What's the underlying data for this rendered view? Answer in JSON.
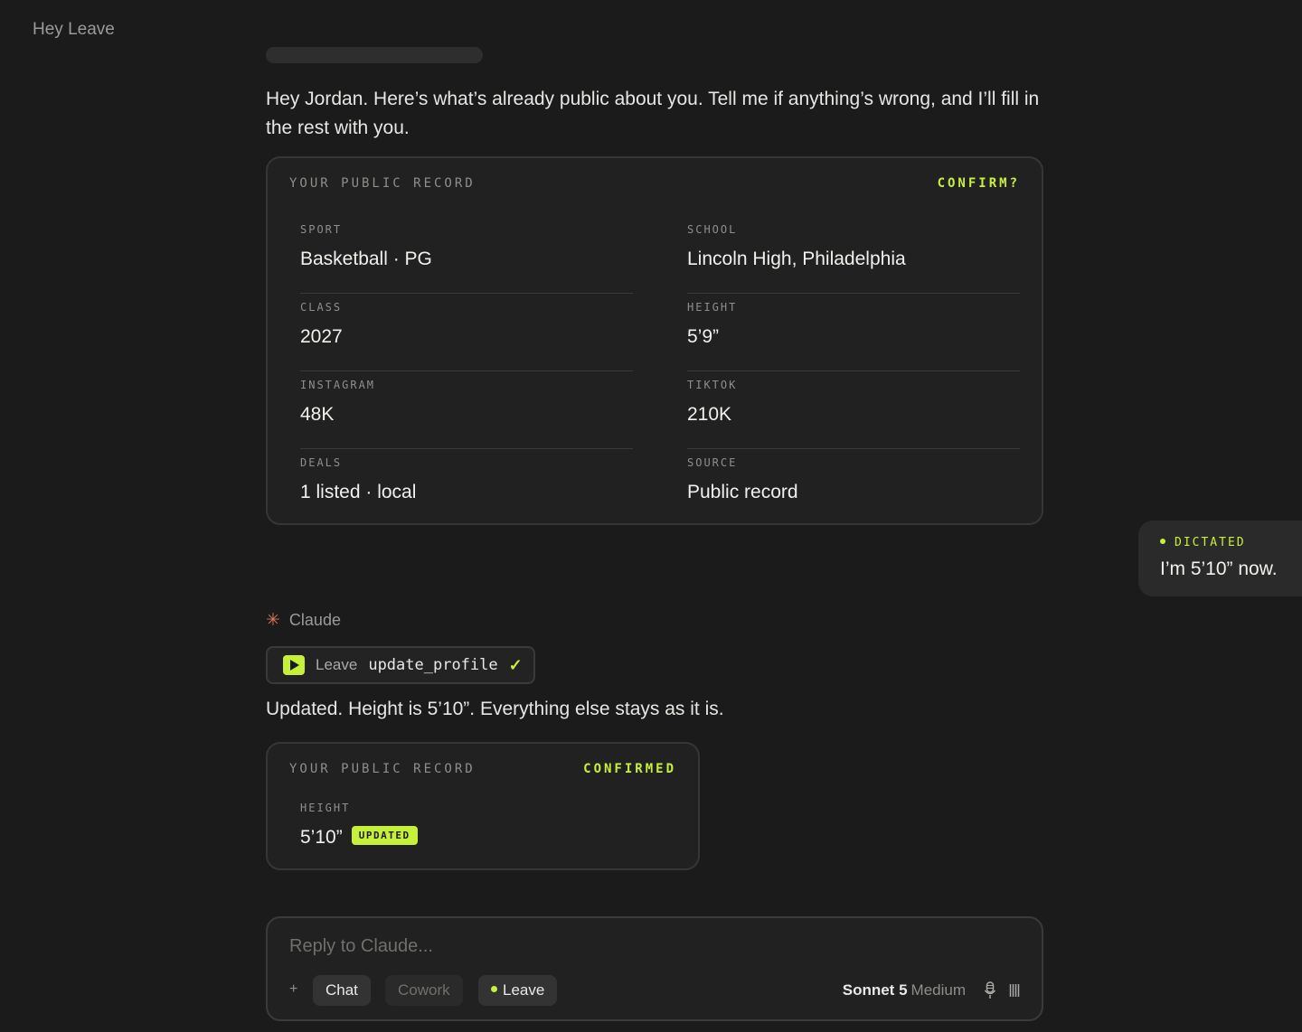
{
  "app": {
    "title": "Hey Leave"
  },
  "intro": "Hey Jordan. Here’s what’s already public about you. Tell me if anything’s wrong, and I’ll fill in the rest with you.",
  "record_card": {
    "title": "YOUR PUBLIC RECORD",
    "status": "CONFIRM?",
    "fields": [
      {
        "label": "SPORT",
        "value": "Basketball · PG"
      },
      {
        "label": "SCHOOL",
        "value": "Lincoln High, Philadelphia"
      },
      {
        "label": "CLASS",
        "value": "2027"
      },
      {
        "label": "HEIGHT",
        "value": "5’9”"
      },
      {
        "label": "INSTAGRAM",
        "value": "48K"
      },
      {
        "label": "TIKTOK",
        "value": "210K"
      },
      {
        "label": "DEALS",
        "value": "1 listed · local"
      },
      {
        "label": "SOURCE",
        "value": "Public record"
      }
    ]
  },
  "user_message": {
    "tag": "DICTATED",
    "text": "I’m 5’10” now."
  },
  "assistant": {
    "name": "Claude",
    "tool_call": {
      "source": "Leave",
      "function": "update_profile",
      "check": "✓"
    },
    "reply": "Updated. Height is 5’10”. Everything else stays as it is."
  },
  "confirm_card": {
    "title": "YOUR PUBLIC RECORD",
    "status": "CONFIRMED",
    "field_label": "HEIGHT",
    "field_value": "5’10”",
    "badge": "UPDATED"
  },
  "composer": {
    "placeholder": "Reply to Claude...",
    "plus": "+",
    "modes": [
      "Chat",
      "Cowork",
      "Leave"
    ],
    "model_name": "Sonnet 5",
    "effort": "Medium"
  },
  "colors": {
    "accent": "#c7f03a",
    "claude_star": "#d97757",
    "background": "#1b1b1b"
  }
}
